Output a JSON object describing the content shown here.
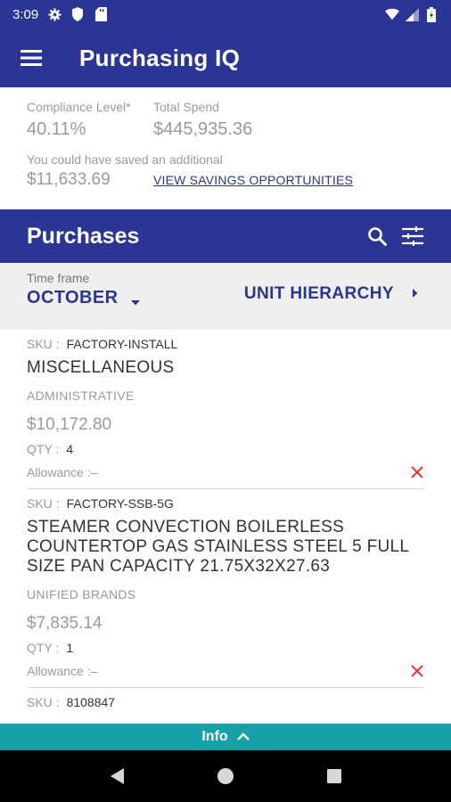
{
  "status_bar": {
    "time": "3:09",
    "icons": [
      "gear-icon",
      "shield-icon",
      "sd-card-icon",
      "wifi-icon",
      "signal-icon",
      "battery-icon"
    ]
  },
  "app_bar": {
    "title": "Purchasing IQ",
    "menu_icon": "menu-icon"
  },
  "summary": {
    "compliance_label": "Compliance Level*",
    "compliance_value": "40.11%",
    "spend_label": "Total Spend",
    "spend_value": "$445,935.36",
    "savings_label": "You could have saved an additional",
    "savings_value": "$11,633.69",
    "savings_link": "VIEW SAVINGS OPPORTUNITIES"
  },
  "purchases": {
    "title": "Purchases",
    "actions": [
      "search-icon",
      "filter-sliders-icon"
    ]
  },
  "filter": {
    "timeframe_label": "Time frame",
    "timeframe_value": "OCTOBER",
    "hierarchy_label": "UNIT HIERARCHY"
  },
  "items": [
    {
      "sku_label": "SKU :",
      "sku": "FACTORY-INSTALL",
      "title": "MISCELLANEOUS",
      "brand": "ADMINISTRATIVE",
      "price": "$10,172.80",
      "qty_label": "QTY :",
      "qty": "4",
      "allowance": "Allowance :–"
    },
    {
      "sku_label": "SKU :",
      "sku": "FACTORY-SSB-5G",
      "title": "STEAMER CONVECTION BOILERLESS COUNTERTOP GAS STAINLESS STEEL 5 FULL SIZE PAN CAPACITY 21.75X32X27.63",
      "brand": "UNIFIED BRANDS",
      "price": "$7,835.14",
      "qty_label": "QTY :",
      "qty": "1",
      "allowance": "Allowance :–"
    },
    {
      "sku_label": "SKU :",
      "sku": "8108847"
    }
  ],
  "info_bar": {
    "label": "Info"
  },
  "colors": {
    "primary": "#2a3595",
    "accent_teal": "#17a0a8",
    "remove_red": "#e53935",
    "muted_text": "#9a9a9a"
  }
}
